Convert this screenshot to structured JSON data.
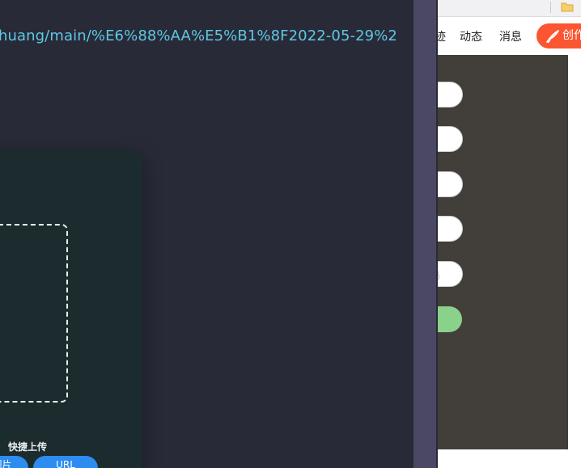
{
  "left_pane": {
    "url_text": "huang/main/%E6%88%AA%E5%B1%8F2022-05-29%2",
    "upload": {
      "quick_upload_title": "快捷上传",
      "image_button_label": "图片",
      "url_button_label": "URL"
    }
  },
  "right_pane": {
    "bookmark_bar": {
      "folder_icon": "folder-icon"
    },
    "nav": {
      "items": [
        "迹",
        "动态",
        "消息"
      ],
      "create_button": {
        "label": "创作",
        "icon": "quill-pen-icon"
      }
    },
    "form": {
      "field_count": 5,
      "field_5_placeholder": "码"
    }
  },
  "colors": {
    "url_text": "#5ec8e6",
    "upload_button": "#2d8cf0",
    "create_button": "#fc5531",
    "submit_button": "#8ad28b"
  }
}
